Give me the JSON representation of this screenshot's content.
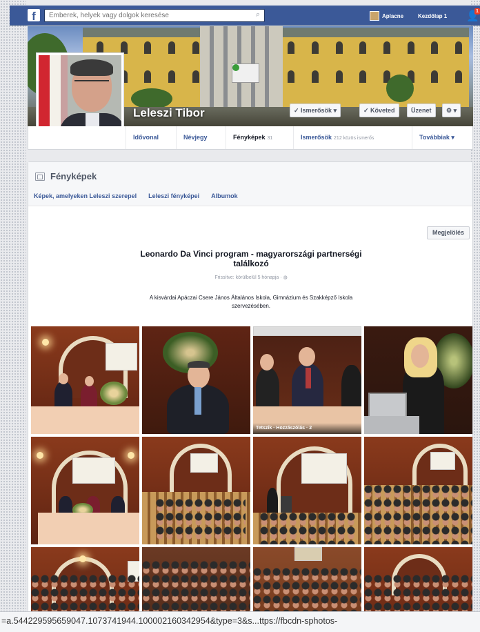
{
  "topbar": {
    "logo": "f",
    "search_placeholder": "Emberek, helyek vagy dolgok keresése",
    "user_name": "Aplacne",
    "home_label": "Kezdőlap",
    "home_count": "1",
    "notif_count": "1",
    "brand_color": "#3b5998"
  },
  "cover": {
    "name": "Leleszi Tibor",
    "friends_btn": "✓ Ismerősök ▾",
    "follow_btn": "✓ Követed",
    "message_btn": "Üzenet",
    "gear_btn": "⚙ ▾"
  },
  "nav": {
    "items": [
      {
        "label": "Idővonal",
        "count": ""
      },
      {
        "label": "Névjegy",
        "count": ""
      },
      {
        "label": "Fényképek",
        "count": "31"
      },
      {
        "label": "Ismerősök",
        "count": "212 közös ismerős"
      },
      {
        "label": "Továbbiak ▾",
        "count": ""
      }
    ]
  },
  "photos_panel": {
    "title": "Fényképek",
    "tabs": [
      "Képek, amelyeken Leleszi szerepel",
      "Leleszi fényképei",
      "Albumok"
    ],
    "report_label": "Megjelölés",
    "album_title": "Leonardo Da Vinci program - magyarországi partnerségi találkozó",
    "album_meta": "Frissítve: körülbelül 5 hónapja ·",
    "album_desc": "A kisvárdai Apáczai Csere János Általános Iskola, Gimnázium és Szakképző Iskola szervezésében.",
    "caption_photo_3": "Tetszik · Hozzászólás · 2"
  },
  "url": "=a.544229595659047.1073741944.100002160342954&type=3&s...ttps://fbcdn-sphotos-"
}
